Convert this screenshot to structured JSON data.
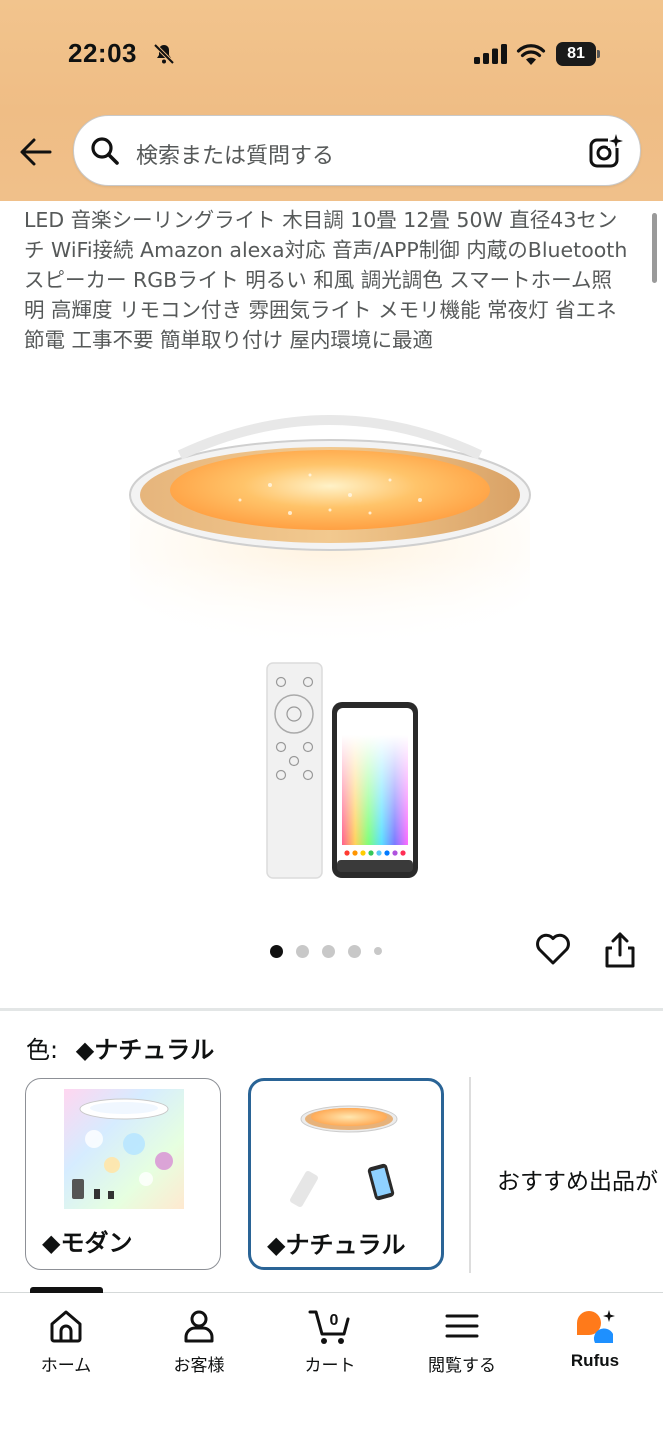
{
  "status_bar": {
    "time": "22:03",
    "battery": "81"
  },
  "search": {
    "placeholder": "検索または質問する"
  },
  "product": {
    "title": "LED 音楽シーリングライト 木目調 10畳 12畳 50W 直径43センチ WiFi接続 Amazon alexa対応 音声/APP制御 内蔵のBluetoothスピーカー RGBライト 明るい 和風 調光調色 スマートホーム照明 高輝度 リモコン付き 雰囲気ライト メモリ機能 常夜灯 省エネ 節電 工事不要 簡単取り付け 屋内環境に最適"
  },
  "carousel": {
    "total": 5,
    "active_index": 0
  },
  "variants": {
    "label": "色:",
    "selected": "◆ナチュラル",
    "options": [
      {
        "label": "◆モダン",
        "selected": false
      },
      {
        "label": "◆ナチュラル",
        "selected": true
      }
    ],
    "recommend_text": "おすすめ出品が"
  },
  "bottom_nav": {
    "items": [
      {
        "label": "ホーム",
        "icon": "home-icon"
      },
      {
        "label": "お客様",
        "icon": "account-icon"
      },
      {
        "label": "カート",
        "icon": "cart-icon",
        "badge": "0"
      },
      {
        "label": "閲覧する",
        "icon": "menu-icon"
      },
      {
        "label": "Rufus",
        "icon": "rufus-icon"
      }
    ]
  },
  "colors": {
    "header_bg": "#efbd85",
    "selected_border": "#2a6496",
    "rufus_orange": "#ff7a1a",
    "rufus_blue": "#1e90ff"
  }
}
